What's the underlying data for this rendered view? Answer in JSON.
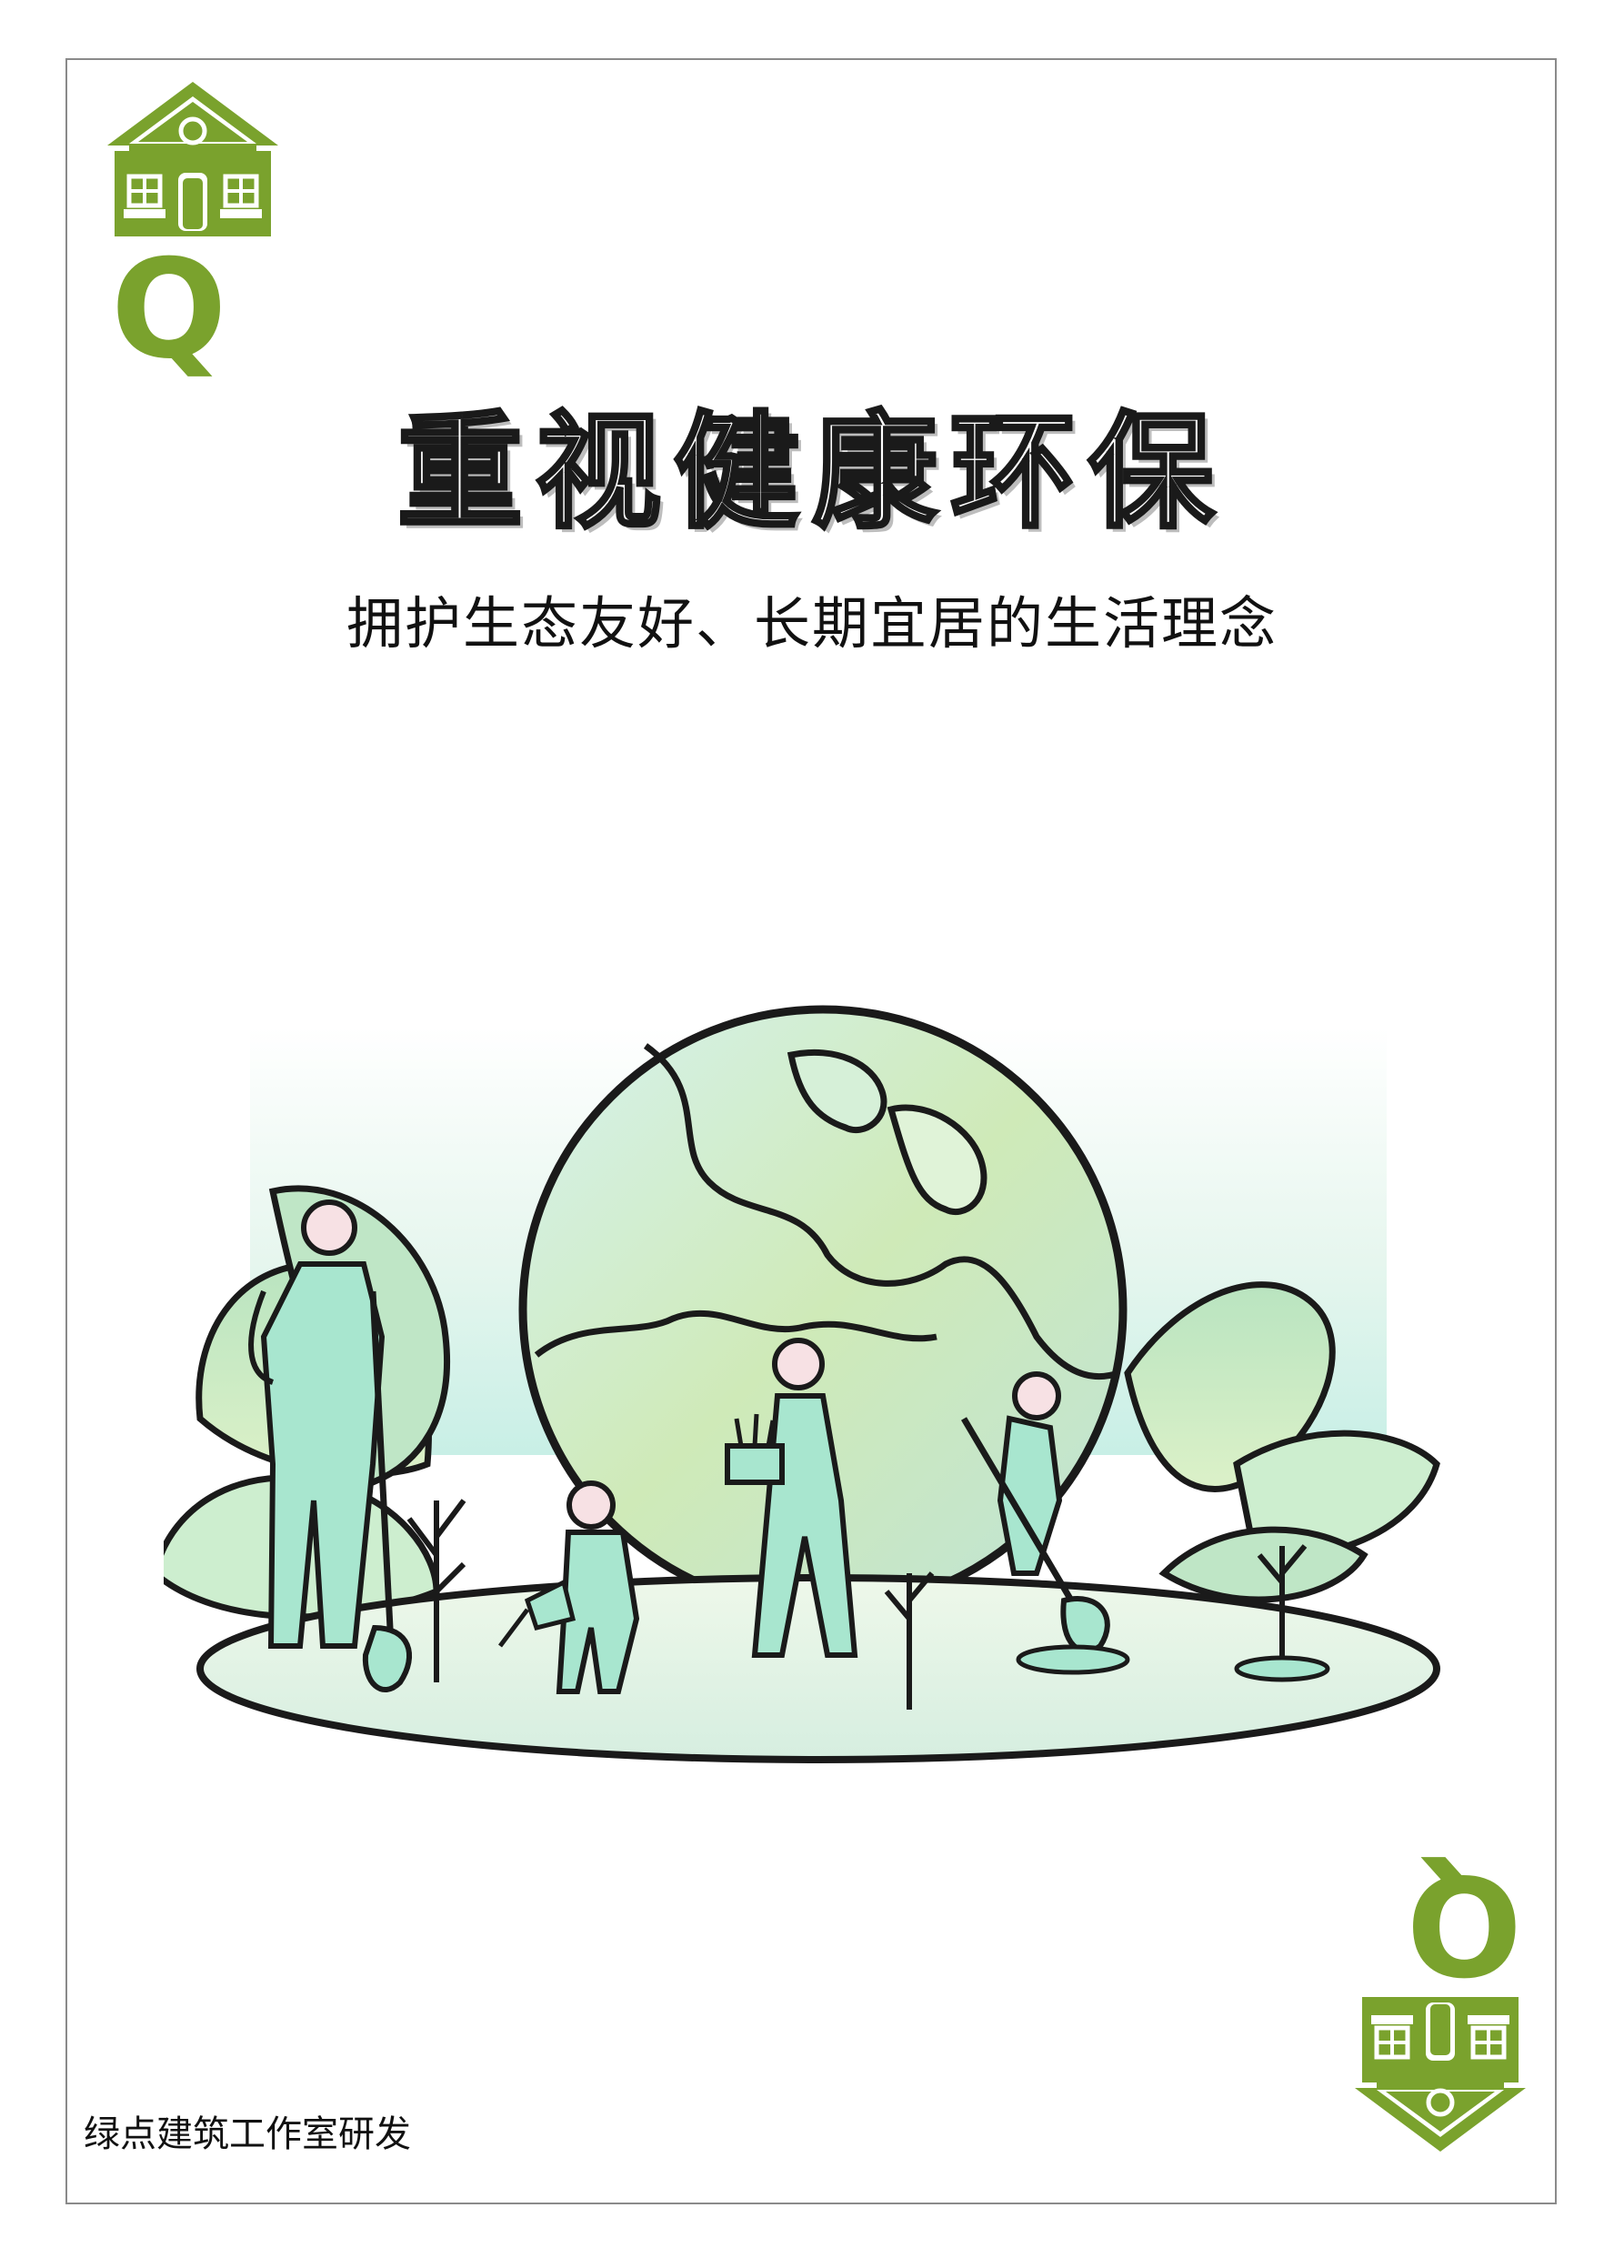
{
  "card": {
    "corner_letter": "Q",
    "title": "重视健康环保",
    "subtitle": "拥护生态友好、长期宜居的生活理念",
    "footer": "绿点建筑工作室研发"
  },
  "icons": {
    "corner_icon": "house-icon",
    "illustration": "earth-planting-people-illustration"
  },
  "colors": {
    "accent_green": "#7aa22d",
    "mint": "#a8e6cf",
    "light_green": "#cfeab0",
    "outline": "#1a1a1a"
  }
}
